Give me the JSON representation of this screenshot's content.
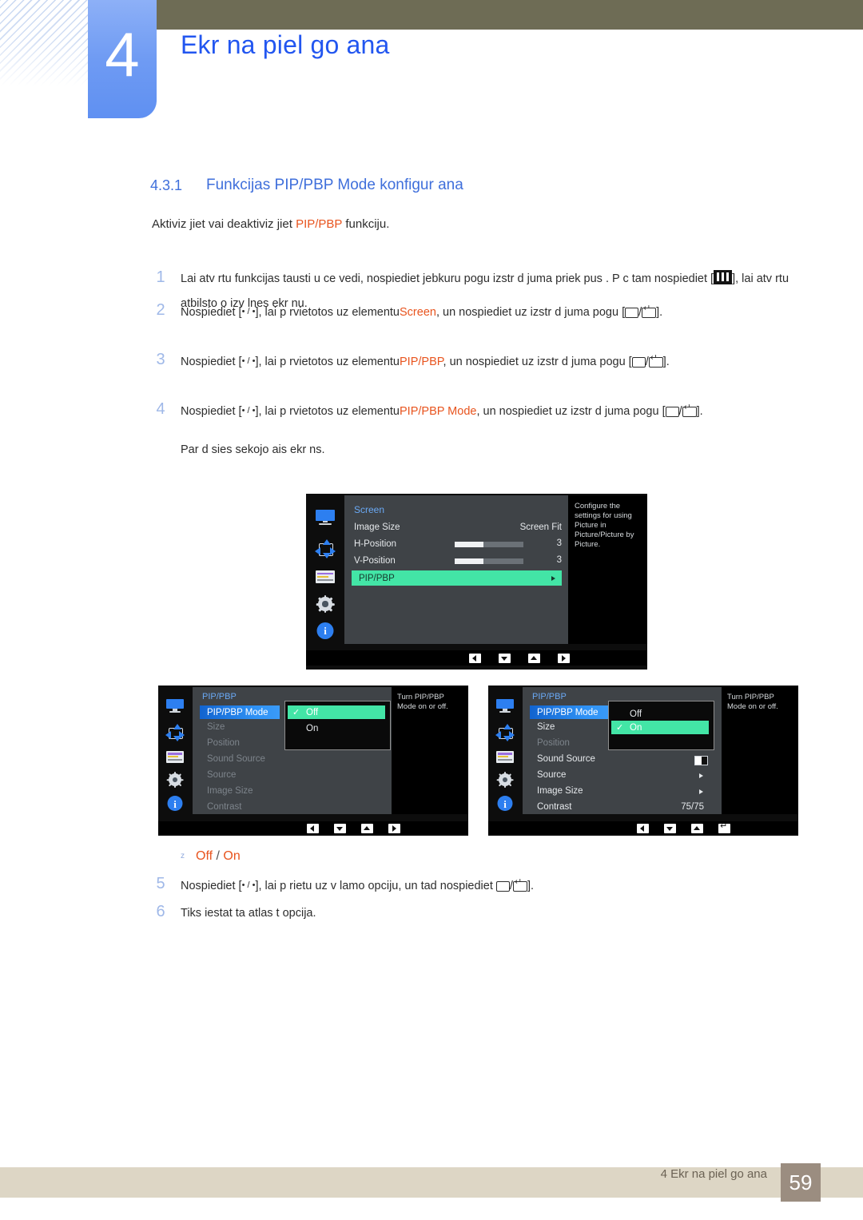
{
  "header": {
    "chapter_number": "4",
    "chapter_title": "Ekr na piel go ana"
  },
  "section": {
    "number": "4.3.1",
    "title": "Funkcijas PIP/PBP  Mode konfigur ana",
    "intro_before": "Aktiviz jiet vai deaktiviz jiet",
    "intro_highlight": "PIP/PBP",
    "intro_after": "funkciju."
  },
  "steps": [
    {
      "index": "1",
      "part1": "Lai atv rtu funkcijas tausti u ce vedi, nospiediet jebkuru pogu izstr d juma priek pus . P c tam nospiediet [",
      "part2": "], lai atv rtu atbilsto o izv lnes ekr nu."
    },
    {
      "index": "2",
      "part1": "Nospiediet [",
      "keys": "• / •",
      "part2": "], lai p rvietotos uz elementu",
      "highlight": "Screen",
      "part3": ", un nospiediet uz izstr d juma pogu [",
      "part4": "]."
    },
    {
      "index": "3",
      "part1": "Nospiediet [",
      "keys": "• / •",
      "part2": "], lai p rvietotos uz elementu",
      "highlight": "PIP/PBP",
      "part3": ", un nospiediet uz izstr d juma pogu [",
      "part4": "]."
    },
    {
      "index": "4",
      "part1": "Nospiediet [",
      "keys": "• / •",
      "part2": "], lai p rvietotos uz elementu",
      "highlight": "PIP/PBP Mode",
      "part3": ", un nospiediet uz izstr d juma pogu [",
      "part4": "]."
    },
    {
      "index": "5",
      "part1": "Nospiediet [",
      "keys": "• / •",
      "part2": "], lai p rietu uz v lamo opciju, un tad nospiediet",
      "part4": "]."
    },
    {
      "index": "6",
      "part1": "Tiks iestat ta atlas t  opcija."
    }
  ],
  "subnote": "Par d sies sekojo ais ekr ns.",
  "bullet": {
    "marker": "z",
    "option_off": "Off",
    "separator": "/",
    "option_on": "On"
  },
  "osd_top": {
    "title": "Screen",
    "help": "Configure the settings for using Picture in Picture/Picture by Picture.",
    "rows": [
      {
        "label": "Image Size",
        "value": "Screen Fit",
        "type": "value"
      },
      {
        "label": "H-Position",
        "value": "3",
        "type": "slider",
        "fill_percent": 42
      },
      {
        "label": "V-Position",
        "value": "3",
        "type": "slider",
        "fill_percent": 42
      },
      {
        "label": "PIP/PBP",
        "value": "",
        "type": "highlight-green"
      }
    ],
    "nav": [
      "left",
      "down",
      "up",
      "right"
    ]
  },
  "osd_left": {
    "title": "PIP/PBP",
    "help": "Turn PIP/PBP Mode on or off.",
    "rows": [
      {
        "label": "PIP/PBP Mode",
        "state": "selected"
      },
      {
        "label": "Size",
        "state": "dim"
      },
      {
        "label": "Position",
        "state": "dim"
      },
      {
        "label": "Sound Source",
        "state": "dim"
      },
      {
        "label": "Source",
        "state": "dim"
      },
      {
        "label": "Image Size",
        "state": "dim"
      },
      {
        "label": "Contrast",
        "state": "dim"
      }
    ],
    "popup": {
      "options": [
        {
          "label": "Off",
          "checked": true
        },
        {
          "label": "On",
          "checked": false
        }
      ]
    },
    "nav": [
      "left",
      "down",
      "up",
      "right"
    ]
  },
  "osd_right": {
    "title": "PIP/PBP",
    "help": "Turn PIP/PBP Mode on or off.",
    "rows": [
      {
        "label": "PIP/PBP Mode",
        "state": "selected",
        "value": ""
      },
      {
        "label": "Size",
        "state": "normal",
        "value": ""
      },
      {
        "label": "Position",
        "state": "dim",
        "value": ""
      },
      {
        "label": "Sound Source",
        "state": "normal",
        "value": "toggle"
      },
      {
        "label": "Source",
        "state": "normal",
        "value": "arrow"
      },
      {
        "label": "Image Size",
        "state": "normal",
        "value": "arrow"
      },
      {
        "label": "Contrast",
        "state": "normal",
        "value": "75/75"
      }
    ],
    "popup": {
      "options": [
        {
          "label": "Off",
          "checked": false
        },
        {
          "label": "On",
          "checked": true
        }
      ]
    },
    "nav": [
      "left",
      "down",
      "up",
      "enter"
    ]
  },
  "footer": {
    "text": "4 Ekr na piel go ana",
    "page": "59"
  },
  "colors": {
    "chapter_blue": "#2256f0",
    "section_blue": "#3f6fdb",
    "highlight_orange": "#e8541e",
    "olive": "#6e6c55",
    "footer_bar": "#ddd6c5",
    "page_box": "#9b8d80",
    "osd_green": "#43e5a6",
    "osd_blue": "#2f92f5"
  }
}
